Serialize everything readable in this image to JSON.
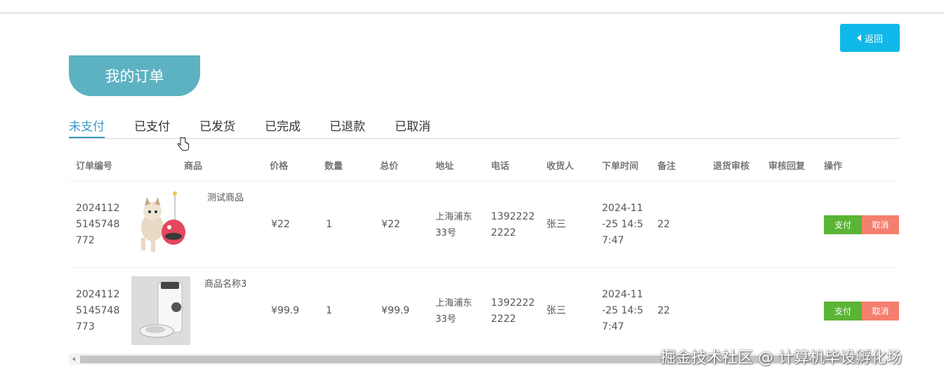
{
  "header": {
    "back_label": "返回",
    "title": "我的订单"
  },
  "tabs": [
    "未支付",
    "已支付",
    "已发货",
    "已完成",
    "已退款",
    "已取消"
  ],
  "columns": [
    "订单编号",
    "商品",
    "价格",
    "数量",
    "总价",
    "地址",
    "电话",
    "收货人",
    "下单时间",
    "备注",
    "退货审核",
    "审核回复",
    "操作"
  ],
  "orders": [
    {
      "order_no": [
        "2024112",
        "5145748",
        "772"
      ],
      "product_name": "测试商品",
      "price": "¥22",
      "qty": "1",
      "total": "¥22",
      "address": [
        "上海浦东",
        "33号"
      ],
      "phone": [
        "1392222",
        "2222"
      ],
      "receiver": "张三",
      "time": [
        "2024-11",
        "-25 14:5",
        "7:47"
      ],
      "note": "22",
      "pay_label": "支付",
      "cancel_label": "取消"
    },
    {
      "order_no": [
        "2024112",
        "5145748",
        "773"
      ],
      "product_name": "商品名称3",
      "price": "¥99.9",
      "qty": "1",
      "total": "¥99.9",
      "address": [
        "上海浦东",
        "33号"
      ],
      "phone": [
        "1392222",
        "2222"
      ],
      "receiver": "张三",
      "time": [
        "2024-11",
        "-25 14:5",
        "7:47"
      ],
      "note": "22",
      "pay_label": "支付",
      "cancel_label": "取消"
    }
  ],
  "watermark": "掘金技术社区 @ 计算机毕设孵化场",
  "colors": {
    "accent": "#0fb8e8",
    "title_tab": "#5db2c2",
    "active_tab": "#3c98c8",
    "pay": "#5bb434",
    "cancel": "#f57f6e"
  }
}
